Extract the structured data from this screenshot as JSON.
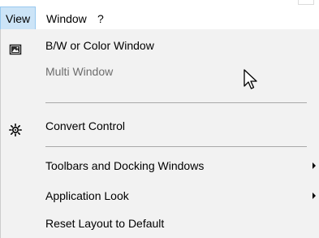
{
  "menubar": {
    "items": [
      {
        "label": "View",
        "active": true
      },
      {
        "label": "Window",
        "active": false
      },
      {
        "label": "?",
        "active": false
      }
    ]
  },
  "dropdown": {
    "items": [
      {
        "label": "B/W or Color Window",
        "icon": "bw-color-window-icon",
        "enabled": true,
        "submenu": false
      },
      {
        "label": "Multi Window",
        "icon": null,
        "enabled": false,
        "submenu": false
      },
      {
        "label": "Convert Control",
        "icon": "convert-control-icon",
        "enabled": true,
        "submenu": false
      },
      {
        "label": "Toolbars and Docking Windows",
        "icon": null,
        "enabled": true,
        "submenu": true
      },
      {
        "label": "Application Look",
        "icon": null,
        "enabled": true,
        "submenu": true
      },
      {
        "label": "Reset Layout to Default",
        "icon": null,
        "enabled": true,
        "submenu": false
      }
    ]
  },
  "colors": {
    "menubar_active_bg": "#cce4f7",
    "menubar_active_border": "#99c9ef",
    "dropdown_bg": "#f2f2f2",
    "disabled_text": "#6d6d6d",
    "separator": "#a9a9a9"
  },
  "cursor": {
    "icon": "arrow-cursor-icon"
  }
}
